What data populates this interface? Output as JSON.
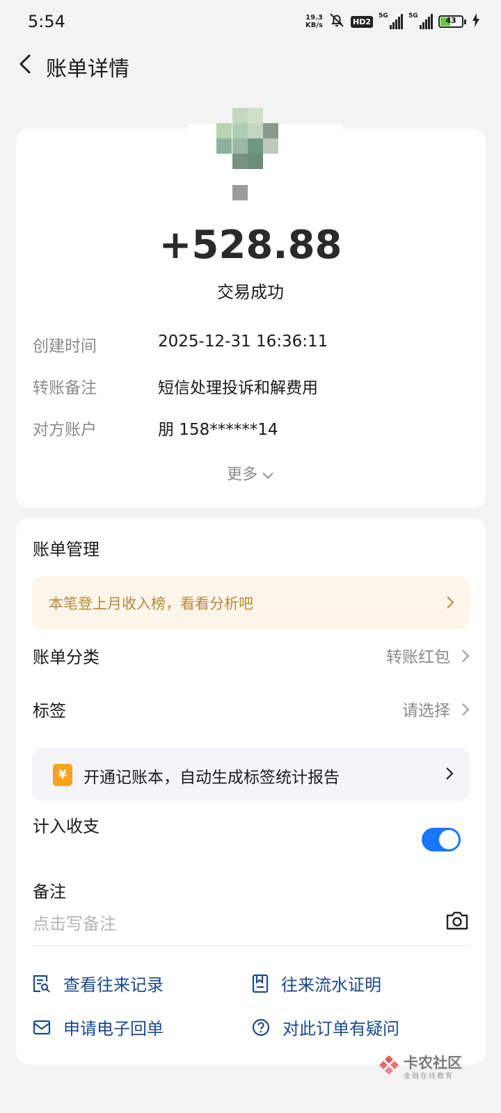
{
  "status_bar": {
    "time": "5:54",
    "net_speed_value": "19.3",
    "net_speed_unit": "KB/s",
    "hd_badge": "HD2",
    "sim1_label": "5G",
    "sim2_label": "5G",
    "battery_level": "43",
    "icons": [
      "mute-bell-icon",
      "hd-voice-icon",
      "signal-icon",
      "battery-icon",
      "charging-icon"
    ]
  },
  "header": {
    "title": "账单详情",
    "back_icon": "chevron-left-icon"
  },
  "transaction": {
    "amount": "+528.88",
    "status": "交易成功",
    "details": [
      {
        "label": "创建时间",
        "value": "2025-12-31 16:36:11"
      },
      {
        "label": "转账备注",
        "value": "短信处理投诉和解费用"
      },
      {
        "label": "对方账户",
        "value": "朋 158******14"
      }
    ],
    "more_label": "更多"
  },
  "management": {
    "title": "账单管理",
    "promo_text": "本笔登上月收入榜，看看分析吧",
    "category_label": "账单分类",
    "category_value": "转账红包",
    "tag_label": "标签",
    "tag_value": "请选择",
    "ledger_icon_glyph": "¥",
    "ledger_text": "开通记账本，自动生成标签统计报告",
    "count_label": "计入收支",
    "count_enabled": true,
    "remark_label": "备注",
    "remark_placeholder": "点击写备注",
    "actions": [
      {
        "label": "查看往来记录",
        "icon": "records-search-icon"
      },
      {
        "label": "往来流水证明",
        "icon": "statement-proof-icon"
      },
      {
        "label": "申请电子回单",
        "icon": "mail-receipt-icon"
      },
      {
        "label": "对此订单有疑问",
        "icon": "question-icon"
      }
    ]
  },
  "watermark": {
    "name": "卡农社区",
    "subtitle": "金融在线教育"
  },
  "colors": {
    "accent": "#1677ff",
    "action_text": "#1a4a8c",
    "promo_bg": "#fcf5ea",
    "promo_text": "#b48a3c",
    "page_bg": "#f3f3f3"
  }
}
